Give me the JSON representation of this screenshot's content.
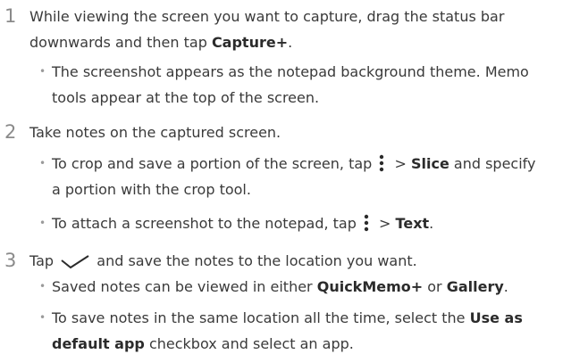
{
  "steps": [
    {
      "number": "1",
      "line1": "While viewing the screen you want to capture, drag the status bar",
      "line2_pre": "downwards and then tap ",
      "line2_bold": "Capture+",
      "line2_post": ".",
      "bullets": [
        {
          "line1": "The screenshot appears as the notepad background theme. Memo",
          "line2": "tools appear at the top of the screen."
        }
      ]
    },
    {
      "number": "2",
      "text": "Take notes on the captured screen.",
      "bullets": [
        {
          "line1_pre": "To crop and save a portion of the screen, tap ",
          "line1_mid": " > ",
          "line1_bold": "Slice",
          "line1_post": " and specify",
          "line2": "a portion with the crop tool."
        },
        {
          "pre": "To attach a screenshot to the notepad, tap ",
          "mid": " > ",
          "bold": "Text",
          "post": "."
        }
      ]
    },
    {
      "number": "3",
      "pre": "Tap ",
      "post": " and save the notes to the location you want.",
      "bullets": [
        {
          "pre": "Saved notes can be viewed in either ",
          "bold1": "QuickMemo+",
          "mid": " or ",
          "bold2": "Gallery",
          "post": "."
        },
        {
          "line1_pre": "To save notes in the same location all the time, select the ",
          "line1_bold": "Use as",
          "line2_bold": "default app",
          "line2_post": " checkbox and select an app."
        }
      ]
    }
  ],
  "icons": {
    "more": "more-options-icon",
    "check": "checkmark-icon"
  },
  "colors": {
    "text": "#3a3a3a",
    "step_number": "#8a8a8a",
    "bullet": "#9a9a9a"
  }
}
